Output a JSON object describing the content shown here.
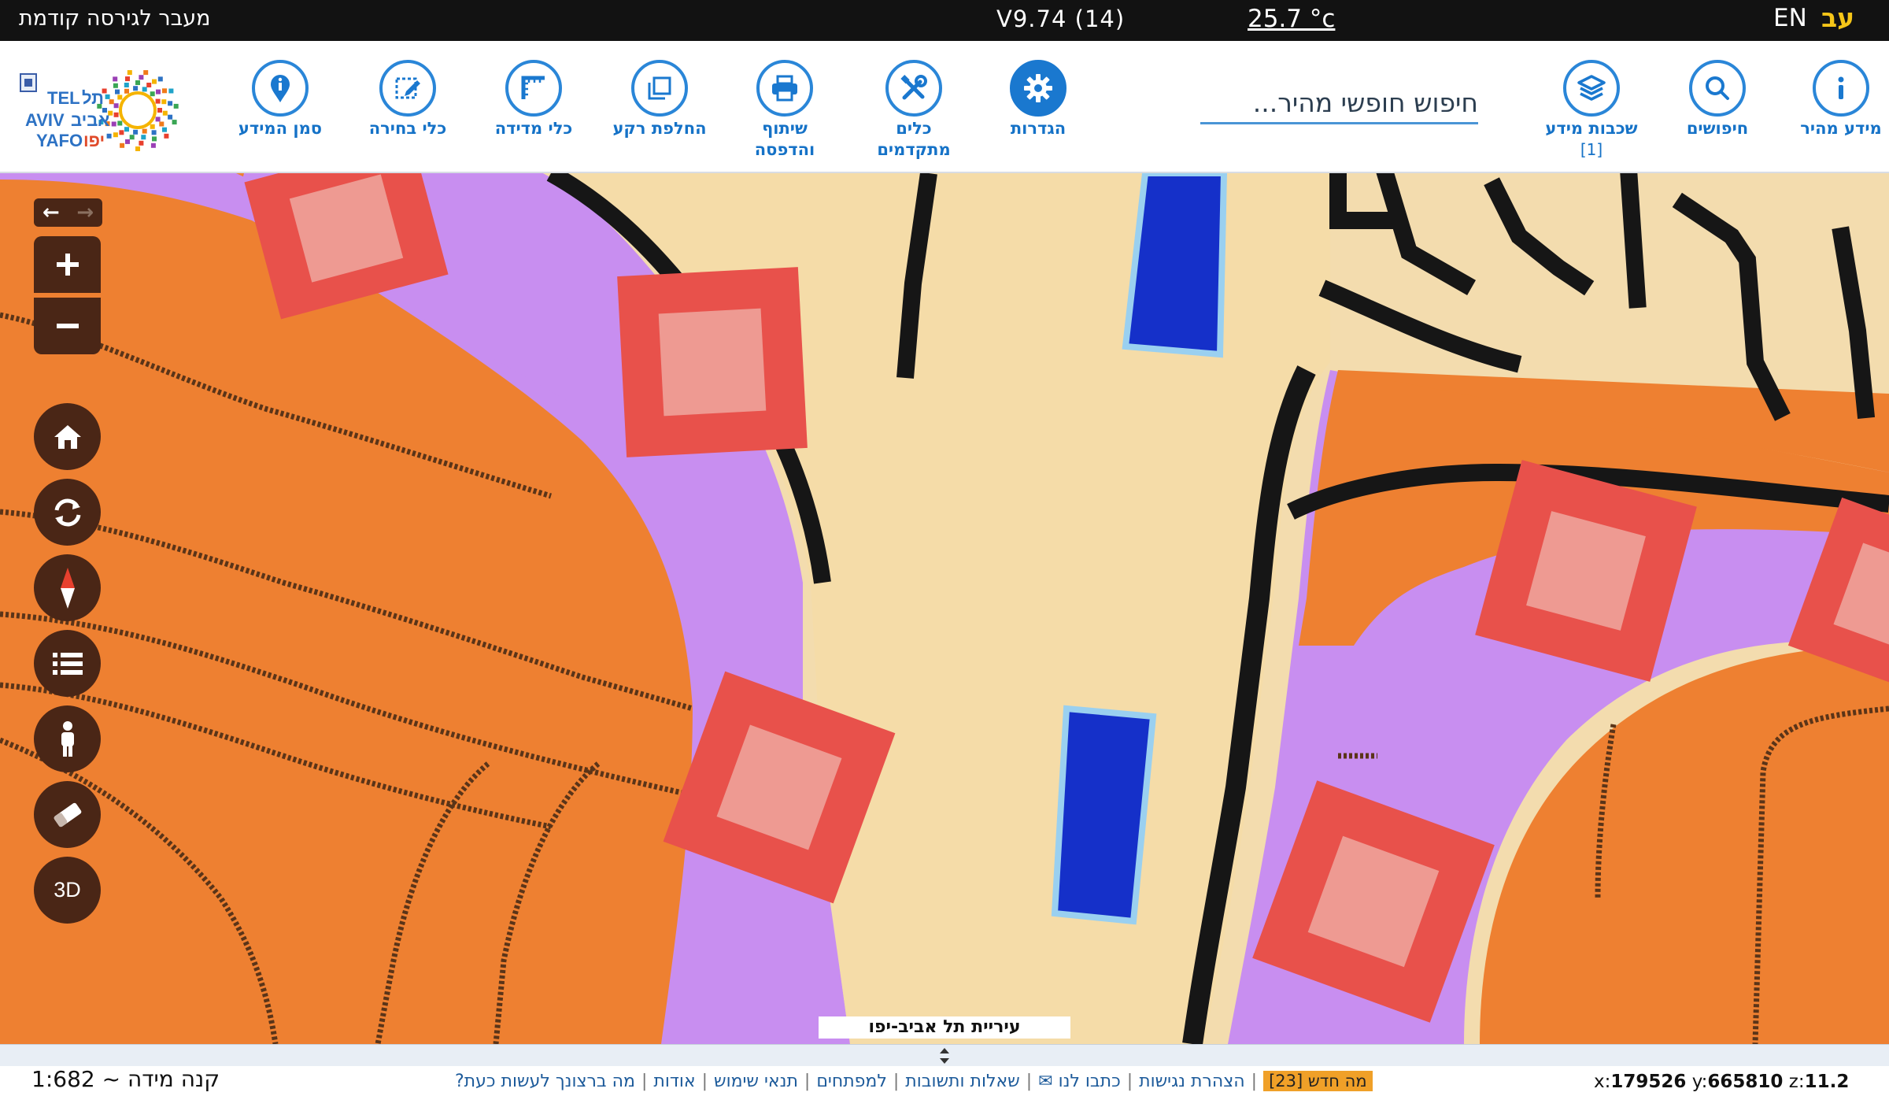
{
  "topbar": {
    "prev_version_link": "מעבר לגירסה קודמת",
    "version": "V9.74 (14)",
    "temperature": "25.7 °c",
    "lang_en": "EN",
    "lang_he": "עב"
  },
  "toolbar": {
    "quick_info": "מידע מהיר",
    "searches": "חיפושים",
    "info_layers": "שכבות מידע",
    "info_layers_count": "[1]",
    "search_placeholder": "חיפוש חופשי מהיר...",
    "settings": "הגדרות",
    "advanced_tools_1": "כלים",
    "advanced_tools_2": "מתקדמים",
    "share_print_1": "שיתוף",
    "share_print_2": "והדפסה",
    "switch_background": "החלפת רקע",
    "measure_tools": "כלי מדידה",
    "select_tools": "כלי בחירה",
    "info_marker": "סמן המידע"
  },
  "logo": {
    "text_tel": "TEL",
    "text_aviv": "AVIV",
    "text_yafo": "YAFO",
    "text_he_1": "תל",
    "text_he_2": "אביב",
    "text_he_3": "יפו"
  },
  "map": {
    "caption": "עיריית תל אביב-יפו",
    "btn_3d": "3D",
    "arrow_back": "←",
    "arrow_forward": "→"
  },
  "footer": {
    "scale": "קנה מידה ~ 1:682",
    "links": [
      "מה ברצונך לעשות כעת?",
      "אודות",
      "תנאי שימוש",
      "למפתחים",
      "שאלות ותשובות",
      "כתבו לנו ✉",
      "הצהרת נגישות"
    ],
    "whats_new": "מה חדש [23]",
    "x_label": "x:",
    "x_value": "179526",
    "y_label": "y:",
    "y_value": "665810",
    "z_label": "z:",
    "z_value": "11.2"
  },
  "colors": {
    "accent": "#1a78cf",
    "map_button": "#4a2616",
    "topbar": "#121212",
    "lang_active": "#f5c518",
    "map_orange": "#ee8031",
    "map_purple": "#c88ef0",
    "map_cream": "#f5dca8",
    "map_red": "#e8514b",
    "map_pink": "#ee9a92",
    "map_blue": "#1530c9",
    "whats_new_badge": "#f0a028"
  },
  "icons": [
    "info-icon",
    "search-icon",
    "layers-icon",
    "gear-icon",
    "tools-icon",
    "printer-icon",
    "copy-icon",
    "ruler-icon",
    "edit-icon",
    "map-pin-icon",
    "home-icon",
    "refresh-icon",
    "compass-icon",
    "list-icon",
    "person-icon",
    "eraser-icon"
  ]
}
